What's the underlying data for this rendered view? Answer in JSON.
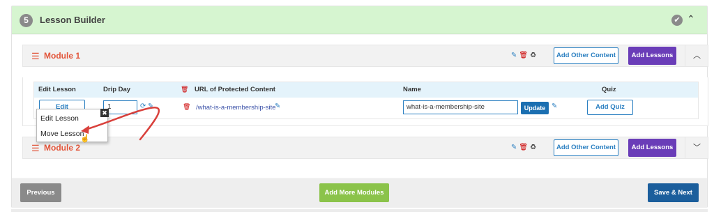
{
  "header": {
    "step_number": "5",
    "title": "Lesson Builder",
    "check_icon": "check-circle-icon",
    "collapse_icon": "chevron-up-icon"
  },
  "modules": [
    {
      "title": "Module 1",
      "add_other_label": "Add Other Content",
      "add_lessons_label": "Add Lessons"
    },
    {
      "title": "Module 2",
      "add_other_label": "Add Other Content",
      "add_lessons_label": "Add Lessons"
    }
  ],
  "table": {
    "headers": {
      "edit": "Edit Lesson",
      "drip": "Drip Day",
      "url": "URL of Protected Content",
      "name": "Name",
      "quiz": "Quiz"
    },
    "row": {
      "edit_label": "Edit",
      "drip_value": "1",
      "url": "/what-is-a-membership-site",
      "name_value": "what-is-a-membership-site",
      "update_label": "Update",
      "add_quiz_label": "Add Quiz"
    }
  },
  "dropdown": {
    "items": [
      "Edit Lesson",
      "Move Lesson"
    ],
    "close_glyph": "✖"
  },
  "footer": {
    "previous_label": "Previous",
    "add_more_label": "Add More Modules",
    "save_next_label": "Save & Next"
  },
  "colors": {
    "header_bg": "#d6f5d0",
    "module_accent": "#e2553a",
    "purple": "#6a3db8",
    "blue": "#2a7fc1",
    "green": "#8bc34a",
    "navy": "#1b5e9c",
    "arrow": "#d9413c"
  }
}
